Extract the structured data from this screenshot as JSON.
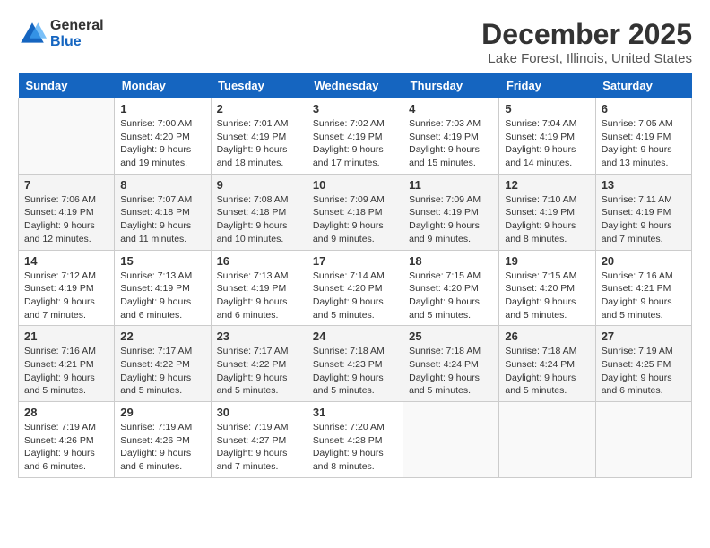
{
  "header": {
    "logo_general": "General",
    "logo_blue": "Blue",
    "month": "December 2025",
    "location": "Lake Forest, Illinois, United States"
  },
  "days_of_week": [
    "Sunday",
    "Monday",
    "Tuesday",
    "Wednesday",
    "Thursday",
    "Friday",
    "Saturday"
  ],
  "weeks": [
    [
      {
        "day": "",
        "info": ""
      },
      {
        "day": "1",
        "info": "Sunrise: 7:00 AM\nSunset: 4:20 PM\nDaylight: 9 hours\nand 19 minutes."
      },
      {
        "day": "2",
        "info": "Sunrise: 7:01 AM\nSunset: 4:19 PM\nDaylight: 9 hours\nand 18 minutes."
      },
      {
        "day": "3",
        "info": "Sunrise: 7:02 AM\nSunset: 4:19 PM\nDaylight: 9 hours\nand 17 minutes."
      },
      {
        "day": "4",
        "info": "Sunrise: 7:03 AM\nSunset: 4:19 PM\nDaylight: 9 hours\nand 15 minutes."
      },
      {
        "day": "5",
        "info": "Sunrise: 7:04 AM\nSunset: 4:19 PM\nDaylight: 9 hours\nand 14 minutes."
      },
      {
        "day": "6",
        "info": "Sunrise: 7:05 AM\nSunset: 4:19 PM\nDaylight: 9 hours\nand 13 minutes."
      }
    ],
    [
      {
        "day": "7",
        "info": "Sunrise: 7:06 AM\nSunset: 4:19 PM\nDaylight: 9 hours\nand 12 minutes."
      },
      {
        "day": "8",
        "info": "Sunrise: 7:07 AM\nSunset: 4:18 PM\nDaylight: 9 hours\nand 11 minutes."
      },
      {
        "day": "9",
        "info": "Sunrise: 7:08 AM\nSunset: 4:18 PM\nDaylight: 9 hours\nand 10 minutes."
      },
      {
        "day": "10",
        "info": "Sunrise: 7:09 AM\nSunset: 4:18 PM\nDaylight: 9 hours\nand 9 minutes."
      },
      {
        "day": "11",
        "info": "Sunrise: 7:09 AM\nSunset: 4:19 PM\nDaylight: 9 hours\nand 9 minutes."
      },
      {
        "day": "12",
        "info": "Sunrise: 7:10 AM\nSunset: 4:19 PM\nDaylight: 9 hours\nand 8 minutes."
      },
      {
        "day": "13",
        "info": "Sunrise: 7:11 AM\nSunset: 4:19 PM\nDaylight: 9 hours\nand 7 minutes."
      }
    ],
    [
      {
        "day": "14",
        "info": "Sunrise: 7:12 AM\nSunset: 4:19 PM\nDaylight: 9 hours\nand 7 minutes."
      },
      {
        "day": "15",
        "info": "Sunrise: 7:13 AM\nSunset: 4:19 PM\nDaylight: 9 hours\nand 6 minutes."
      },
      {
        "day": "16",
        "info": "Sunrise: 7:13 AM\nSunset: 4:19 PM\nDaylight: 9 hours\nand 6 minutes."
      },
      {
        "day": "17",
        "info": "Sunrise: 7:14 AM\nSunset: 4:20 PM\nDaylight: 9 hours\nand 5 minutes."
      },
      {
        "day": "18",
        "info": "Sunrise: 7:15 AM\nSunset: 4:20 PM\nDaylight: 9 hours\nand 5 minutes."
      },
      {
        "day": "19",
        "info": "Sunrise: 7:15 AM\nSunset: 4:20 PM\nDaylight: 9 hours\nand 5 minutes."
      },
      {
        "day": "20",
        "info": "Sunrise: 7:16 AM\nSunset: 4:21 PM\nDaylight: 9 hours\nand 5 minutes."
      }
    ],
    [
      {
        "day": "21",
        "info": "Sunrise: 7:16 AM\nSunset: 4:21 PM\nDaylight: 9 hours\nand 5 minutes."
      },
      {
        "day": "22",
        "info": "Sunrise: 7:17 AM\nSunset: 4:22 PM\nDaylight: 9 hours\nand 5 minutes."
      },
      {
        "day": "23",
        "info": "Sunrise: 7:17 AM\nSunset: 4:22 PM\nDaylight: 9 hours\nand 5 minutes."
      },
      {
        "day": "24",
        "info": "Sunrise: 7:18 AM\nSunset: 4:23 PM\nDaylight: 9 hours\nand 5 minutes."
      },
      {
        "day": "25",
        "info": "Sunrise: 7:18 AM\nSunset: 4:24 PM\nDaylight: 9 hours\nand 5 minutes."
      },
      {
        "day": "26",
        "info": "Sunrise: 7:18 AM\nSunset: 4:24 PM\nDaylight: 9 hours\nand 5 minutes."
      },
      {
        "day": "27",
        "info": "Sunrise: 7:19 AM\nSunset: 4:25 PM\nDaylight: 9 hours\nand 6 minutes."
      }
    ],
    [
      {
        "day": "28",
        "info": "Sunrise: 7:19 AM\nSunset: 4:26 PM\nDaylight: 9 hours\nand 6 minutes."
      },
      {
        "day": "29",
        "info": "Sunrise: 7:19 AM\nSunset: 4:26 PM\nDaylight: 9 hours\nand 6 minutes."
      },
      {
        "day": "30",
        "info": "Sunrise: 7:19 AM\nSunset: 4:27 PM\nDaylight: 9 hours\nand 7 minutes."
      },
      {
        "day": "31",
        "info": "Sunrise: 7:20 AM\nSunset: 4:28 PM\nDaylight: 9 hours\nand 8 minutes."
      },
      {
        "day": "",
        "info": ""
      },
      {
        "day": "",
        "info": ""
      },
      {
        "day": "",
        "info": ""
      }
    ]
  ]
}
